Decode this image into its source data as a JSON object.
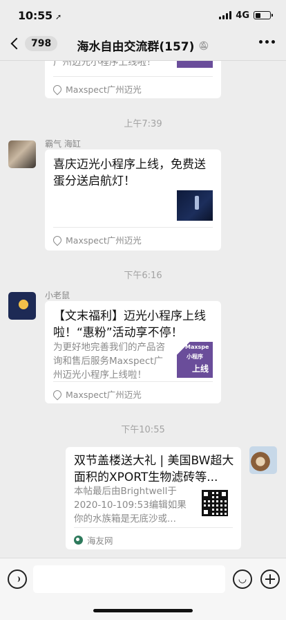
{
  "status_bar": {
    "time": "10:55",
    "location_arrow": "➚",
    "network": "4G"
  },
  "nav": {
    "unread_count": "798",
    "title": "海水自由交流群(157)",
    "mute_icon": "mute-bell-icon"
  },
  "messages": {
    "partial_card": {
      "desc_tail": "广州迈光小程序上线啦！",
      "source": "Maxspect广州迈光"
    },
    "ts1": "上午7:39",
    "msg1": {
      "sender": "霸气 海缸",
      "title": "喜庆迈光小程序上线，免费送蛋分送启航灯！",
      "source": "Maxspect广州迈光"
    },
    "ts2": "下午6:16",
    "msg2": {
      "sender": "小老鼠",
      "title": "【文末福利】迈光小程序上线啦！“惠粉”活动享不停！",
      "desc": "为更好地完善我们的产品咨询和售后服务Maxspect广州迈光小程序上线啦！",
      "thumb_text_1": "Maxspe",
      "thumb_text_2": "小程序",
      "thumb_text_3": "上线",
      "source": "Maxspect广州迈光"
    },
    "ts3": "下午10:55",
    "msg3": {
      "title": "双节盖楼送大礼 | 美国BW超大面积的XPORT生物滤砖等...",
      "desc": "本帖最后由Brightwell于2020-10-109:53编辑如果你的水族箱是无底沙或...",
      "source": "海友网"
    }
  },
  "input_bar": {
    "placeholder": ""
  },
  "colors": {
    "background": "#ededed",
    "card": "#ffffff",
    "muted_text": "#8a8a8a",
    "timestamp": "#a3a3a3"
  }
}
